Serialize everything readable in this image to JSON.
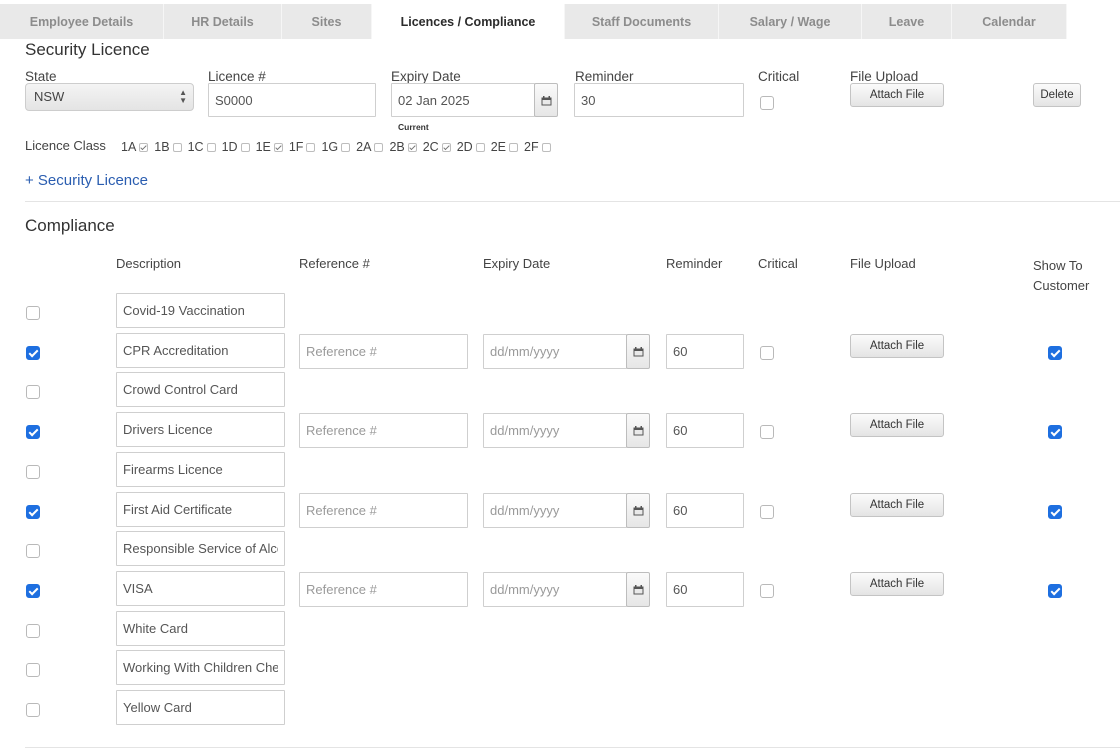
{
  "tabs": [
    {
      "label": "Employee Details",
      "active": false
    },
    {
      "label": "HR Details",
      "active": false
    },
    {
      "label": "Sites",
      "active": false
    },
    {
      "label": "Licences / Compliance",
      "active": true
    },
    {
      "label": "Staff Documents",
      "active": false
    },
    {
      "label": "Salary / Wage",
      "active": false
    },
    {
      "label": "Leave",
      "active": false
    },
    {
      "label": "Calendar",
      "active": false
    }
  ],
  "security": {
    "title": "Security Licence",
    "state_label": "State",
    "state_value": "NSW",
    "licence_label": "Licence #",
    "licence_value": "S0000",
    "expiry_label": "Expiry Date",
    "expiry_value": "02 Jan 2025",
    "expiry_status": "Current",
    "reminder_label": "Reminder",
    "reminder_value": "30",
    "critical_label": "Critical",
    "critical_checked": false,
    "upload_label": "File Upload",
    "attach_label": "Attach File",
    "delete_label": "Delete",
    "class_label": "Licence Class",
    "classes": [
      {
        "code": "1A",
        "checked": true
      },
      {
        "code": "1B",
        "checked": false
      },
      {
        "code": "1C",
        "checked": false
      },
      {
        "code": "1D",
        "checked": false
      },
      {
        "code": "1E",
        "checked": true
      },
      {
        "code": "1F",
        "checked": false
      },
      {
        "code": "1G",
        "checked": false
      },
      {
        "code": "2A",
        "checked": false
      },
      {
        "code": "2B",
        "checked": true
      },
      {
        "code": "2C",
        "checked": true
      },
      {
        "code": "2D",
        "checked": false
      },
      {
        "code": "2E",
        "checked": false
      },
      {
        "code": "2F",
        "checked": false
      }
    ],
    "add_link": "+ Security Licence"
  },
  "compliance": {
    "title": "Compliance",
    "headers": {
      "description": "Description",
      "reference": "Reference #",
      "expiry": "Expiry Date",
      "reminder": "Reminder",
      "critical": "Critical",
      "upload": "File Upload",
      "show_line1": "Show To",
      "show_line2": "Customer"
    },
    "placeholders": {
      "reference": "Reference #",
      "expiry": "dd/mm/yyyy"
    },
    "attach_label": "Attach File",
    "items": [
      {
        "description": "Covid-19 Vaccination",
        "enabled": false
      },
      {
        "description": "CPR Accreditation",
        "enabled": true,
        "reminder": "60",
        "critical": false,
        "show_to_customer": true
      },
      {
        "description": "Crowd Control Card",
        "enabled": false
      },
      {
        "description": "Drivers Licence",
        "enabled": true,
        "reminder": "60",
        "critical": false,
        "show_to_customer": true
      },
      {
        "description": "Firearms Licence",
        "enabled": false
      },
      {
        "description": "First Aid Certificate",
        "enabled": true,
        "reminder": "60",
        "critical": false,
        "show_to_customer": true
      },
      {
        "description": "Responsible Service of Alcohol",
        "enabled": false
      },
      {
        "description": "VISA",
        "enabled": true,
        "reminder": "60",
        "critical": false,
        "show_to_customer": true
      },
      {
        "description": "White Card",
        "enabled": false
      },
      {
        "description": "Working With Children Check",
        "enabled": false
      },
      {
        "description": "Yellow Card",
        "enabled": false
      }
    ]
  },
  "colors": {
    "accent": "#1e6fe0",
    "link": "#2a5db0",
    "tab_bg": "#e9e9e9"
  }
}
